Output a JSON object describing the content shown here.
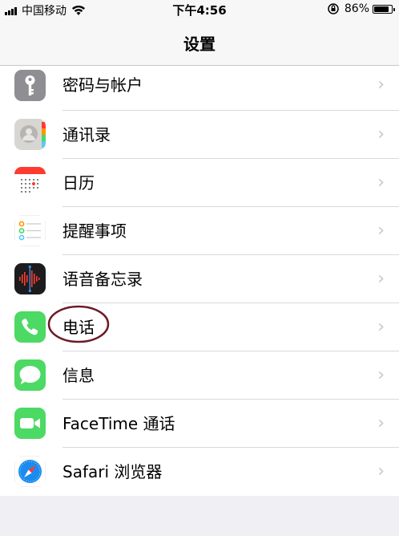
{
  "status_bar": {
    "carrier": "中国移动",
    "time": "下午4:56",
    "battery_percent": "86%",
    "battery_level": 0.86
  },
  "nav": {
    "title": "设置"
  },
  "settings": {
    "items": [
      {
        "label": "密码与帐户",
        "icon": "key-icon"
      },
      {
        "label": "通讯录",
        "icon": "contacts-icon"
      },
      {
        "label": "日历",
        "icon": "calendar-icon"
      },
      {
        "label": "提醒事项",
        "icon": "reminders-icon"
      },
      {
        "label": "语音备忘录",
        "icon": "voice-memos-icon"
      },
      {
        "label": "电话",
        "icon": "phone-icon"
      },
      {
        "label": "信息",
        "icon": "messages-icon"
      },
      {
        "label": "FaceTime 通话",
        "icon": "facetime-icon"
      },
      {
        "label": "Safari 浏览器",
        "icon": "safari-icon"
      }
    ],
    "chevron": "›"
  },
  "colors": {
    "phone_green": "#4cd964",
    "annotation": "#6b1a26",
    "chevron": "#c7c7cc"
  }
}
